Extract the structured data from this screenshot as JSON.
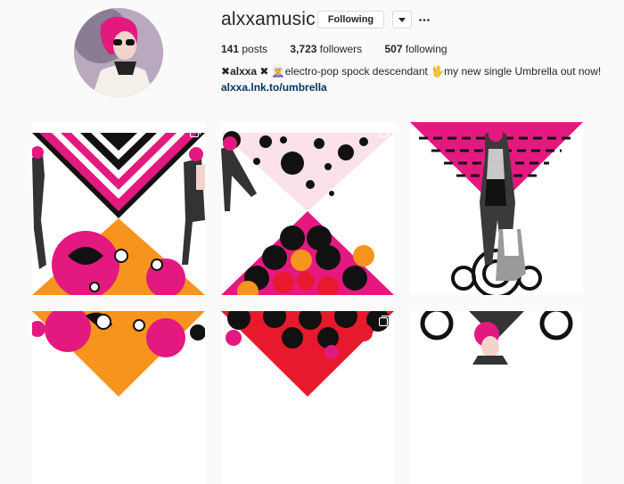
{
  "profile": {
    "username": "alxxamusic",
    "follow_label": "Following",
    "posts_count": "141",
    "posts_label": "posts",
    "followers_count": "3,723",
    "followers_label": "followers",
    "following_count": "507",
    "following_label": "following",
    "bio_prefix": "✖",
    "bio_name": "alxxa",
    "bio_text": " ✖ 🧝‍♀️electro-pop spock descendant 🖖my new single Umbrella out now!",
    "link": "alxxa.lnk.to/umbrella"
  },
  "icons": {
    "dropdown": "chevron-down-icon",
    "more": "ellipsis-icon",
    "multi": "carousel-icon"
  },
  "colors": {
    "pink": "#e4197f",
    "orange": "#f7941d",
    "red": "#e8192c",
    "link": "#003569"
  },
  "posts": [
    {
      "label": "post-1-pink-chevron-floral"
    },
    {
      "label": "post-2-polka-dot-scales"
    },
    {
      "label": "post-3-pink-husky-mandala"
    },
    {
      "label": "post-4-floral-orange"
    },
    {
      "label": "post-5-red-scales"
    },
    {
      "label": "post-6-mandala-portrait"
    }
  ]
}
